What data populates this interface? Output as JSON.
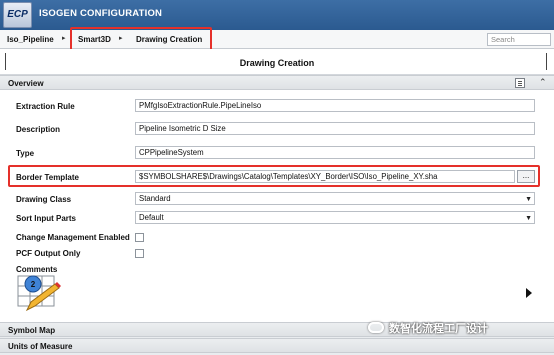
{
  "app": {
    "logo": "ECP",
    "title": "ISOGEN CONFIGURATION"
  },
  "breadcrumb": {
    "items": [
      "Iso_Pipeline",
      "Smart3D",
      "Drawing Creation"
    ],
    "separator": "▸"
  },
  "search": {
    "placeholder": "Search"
  },
  "page": {
    "title": "Drawing Creation"
  },
  "sections": {
    "overview": "Overview",
    "symbol_map": "Symbol Map",
    "units_of_measure": "Units of Measure"
  },
  "form": {
    "extraction_rule": {
      "label": "Extraction Rule",
      "value": "PMfgIsoExtractionRule.PipeLineIso"
    },
    "description": {
      "label": "Description",
      "value": "Pipeline Isometric D Size"
    },
    "type": {
      "label": "Type",
      "value": "CPPipelineSystem"
    },
    "border_template": {
      "label": "Border Template",
      "value": "$SYMBOLSHARE$\\Drawings\\Catalog\\Templates\\XY_Border\\ISO\\Iso_Pipeline_XY.sha",
      "browse": "..."
    },
    "drawing_class": {
      "label": "Drawing Class",
      "value": "Standard"
    },
    "sort_input_parts": {
      "label": "Sort Input Parts",
      "value": "Default"
    },
    "change_management": {
      "label": "Change Management Enabled",
      "checked": false
    },
    "pcf_output_only": {
      "label": "PCF Output Only",
      "checked": false
    },
    "comments": {
      "label": "Comments",
      "badge": "2"
    }
  },
  "watermark": "数智化流程工厂设计",
  "icons": [
    "app-logo",
    "list-view-icon",
    "collapse-icon",
    "dropdown-arrow-icon",
    "comments-edit-icon",
    "next-arrow-icon",
    "wechat-icon"
  ],
  "colors": {
    "titlebar": "#2f5f98",
    "highlight": "#e5302a"
  }
}
